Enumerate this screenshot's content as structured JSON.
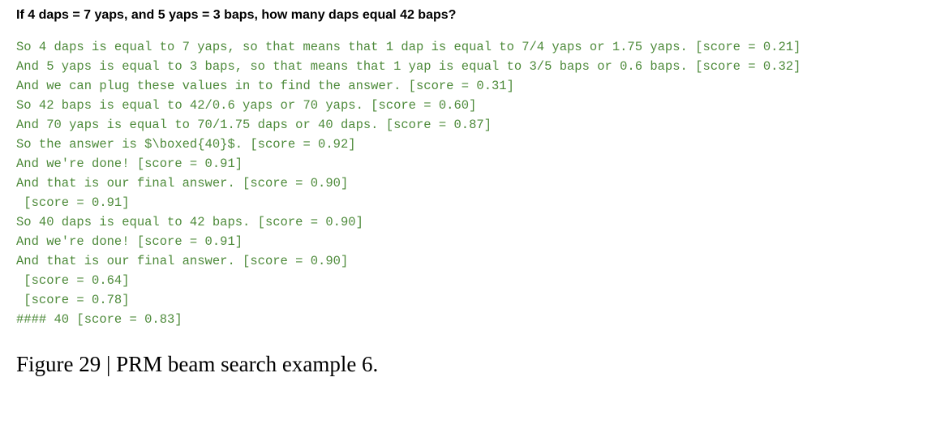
{
  "problem": {
    "title": "If 4 daps = 7 yaps, and 5 yaps = 3 baps, how many daps equal 42 baps?"
  },
  "solution": {
    "lines": [
      "So 4 daps is equal to 7 yaps, so that means that 1 dap is equal to 7/4 yaps or 1.75 yaps. [score = 0.21]",
      "And 5 yaps is equal to 3 baps, so that means that 1 yap is equal to 3/5 baps or 0.6 baps. [score = 0.32]",
      "And we can plug these values in to find the answer. [score = 0.31]",
      "So 42 baps is equal to 42/0.6 yaps or 70 yaps. [score = 0.60]",
      "And 70 yaps is equal to 70/1.75 daps or 40 daps. [score = 0.87]",
      "So the answer is $\\boxed{40}$. [score = 0.92]",
      "And we're done! [score = 0.91]",
      "And that is our final answer. [score = 0.90]",
      " [score = 0.91]",
      "So 40 daps is equal to 42 baps. [score = 0.90]",
      "And we're done! [score = 0.91]",
      "And that is our final answer. [score = 0.90]",
      " [score = 0.64]",
      " [score = 0.78]",
      "#### 40 [score = 0.83]"
    ]
  },
  "caption": {
    "text": "Figure 29 | PRM beam search example 6."
  }
}
